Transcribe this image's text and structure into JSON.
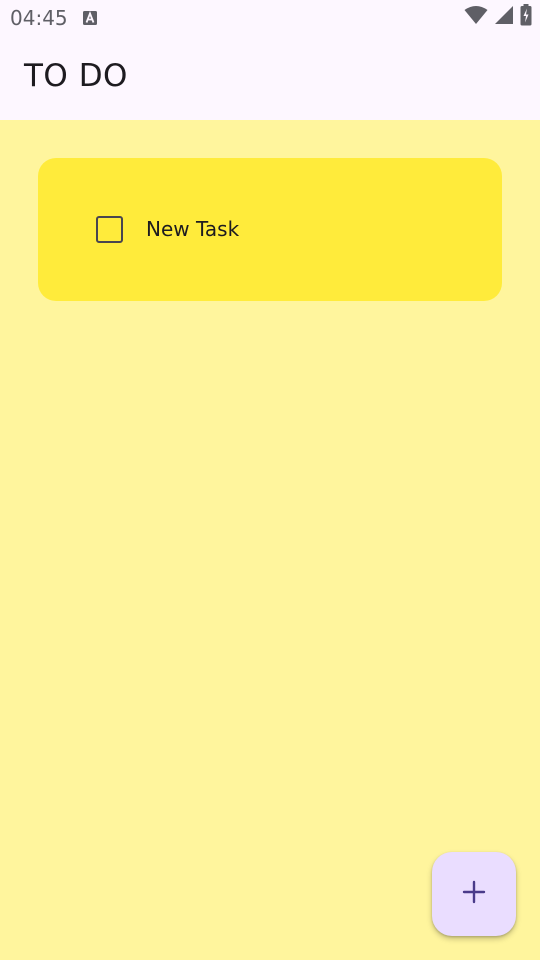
{
  "status_bar": {
    "time": "04:45",
    "icons": [
      "a-notification-icon",
      "wifi-icon",
      "cellular-signal-icon",
      "battery-charging-icon"
    ]
  },
  "app_bar": {
    "title": "TO DO"
  },
  "tasks": [
    {
      "label": "New Task",
      "checked": false
    }
  ],
  "fab": {
    "icon": "plus-icon"
  },
  "colors": {
    "app_bar_bg": "#FDF7FF",
    "content_bg": "#FFF59D",
    "card_bg": "#FFEB3B",
    "fab_bg": "#EADDFF",
    "fab_icon": "#4A3A8A"
  }
}
